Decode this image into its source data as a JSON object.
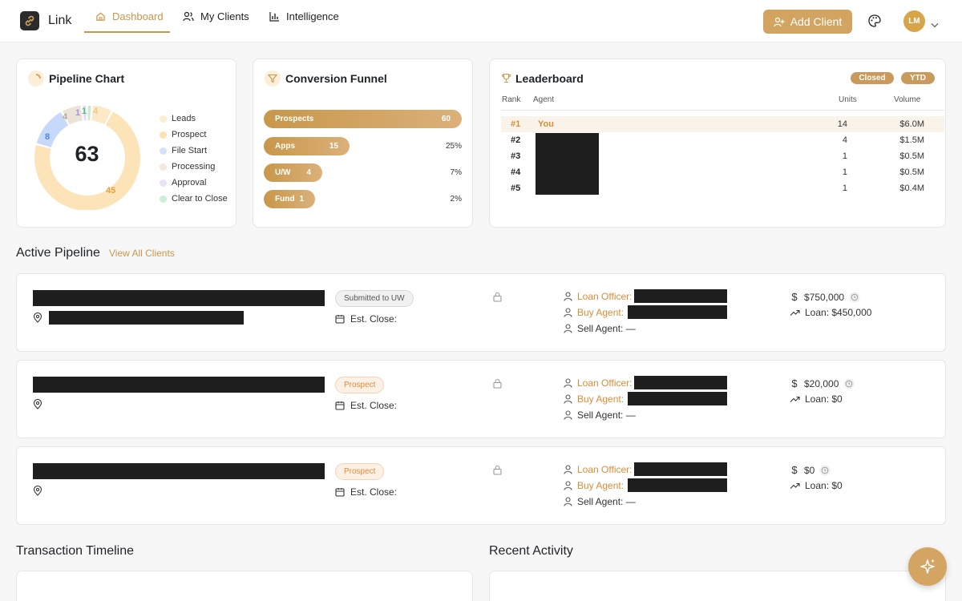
{
  "app": {
    "name": "Link"
  },
  "nav": {
    "tabs": [
      {
        "label": "Dashboard",
        "icon": "home-icon",
        "active": true
      },
      {
        "label": "My Clients",
        "icon": "users-icon"
      },
      {
        "label": "Intelligence",
        "icon": "bar-chart-icon"
      }
    ],
    "add_client_label": "Add Client",
    "avatar_initials": "LM"
  },
  "colors": {
    "accent": "#c8974a",
    "orange": "#d98c3a"
  },
  "pipeline_chart": {
    "title": "Pipeline Chart",
    "total": "63",
    "segments": [
      {
        "name": "Leads",
        "value": 4,
        "color": "#fde9c7",
        "label": "4"
      },
      {
        "name": "Prospect",
        "value": 45,
        "color": "#fde3b8",
        "label": "45"
      },
      {
        "name": "File Start",
        "value": 8,
        "color": "#c7d9fa",
        "label": "8"
      },
      {
        "name": "Processing",
        "value": 4,
        "color": "#ede4d9",
        "label": "4"
      },
      {
        "name": "Approval",
        "value": 1,
        "color": "#e4dbf7",
        "label": "1"
      },
      {
        "name": "Clear to Close",
        "value": 1,
        "color": "#c8ecd3",
        "label": "1"
      }
    ]
  },
  "funnel": {
    "title": "Conversion Funnel",
    "stages": [
      {
        "name": "Prospects",
        "count": "60",
        "pct": ""
      },
      {
        "name": "Apps",
        "count": "15",
        "pct": "25%"
      },
      {
        "name": "U/W",
        "count": "4",
        "pct": "7%"
      },
      {
        "name": "Fund",
        "count": "1",
        "pct": "2%"
      }
    ]
  },
  "leaderboard": {
    "title": "Leaderboard",
    "filter_closed": "Closed",
    "filter_period": "YTD",
    "headers": {
      "rank": "Rank",
      "agent": "Agent",
      "units": "Units",
      "volume": "Volume"
    },
    "rows": [
      {
        "rank": "#1",
        "agent": "You",
        "units": "14",
        "volume": "$6.0M"
      },
      {
        "rank": "#2",
        "agent": "",
        "units": "4",
        "volume": "$1.5M"
      },
      {
        "rank": "#3",
        "agent": "",
        "units": "1",
        "volume": "$0.5M"
      },
      {
        "rank": "#4",
        "agent": "",
        "units": "1",
        "volume": "$0.5M"
      },
      {
        "rank": "#5",
        "agent": "",
        "units": "1",
        "volume": "$0.4M"
      }
    ]
  },
  "active_pipeline": {
    "title": "Active Pipeline",
    "view_all": "View All Clients",
    "clients": [
      {
        "status": "Submitted to UW",
        "status_type": "uw",
        "est_close": "Est. Close:",
        "loan_officer_label": "Loan Officer:",
        "buy_agent_label": "Buy Agent:",
        "sell_agent": "Sell Agent: —",
        "price": "$750,000",
        "loan": "Loan: $450,000"
      },
      {
        "status": "Prospect",
        "status_type": "prospect",
        "est_close": "Est. Close:",
        "loan_officer_label": "Loan Officer:",
        "buy_agent_label": "Buy Agent:",
        "sell_agent": "Sell Agent: —",
        "price": "$20,000",
        "loan": "Loan: $0"
      },
      {
        "status": "Prospect",
        "status_type": "prospect",
        "est_close": "Est. Close:",
        "loan_officer_label": "Loan Officer:",
        "buy_agent_label": "Buy Agent:",
        "sell_agent": "Sell Agent: —",
        "price": "$0",
        "loan": "Loan: $0"
      }
    ]
  },
  "sections": {
    "timeline_title": "Transaction Timeline",
    "activity_title": "Recent Activity"
  }
}
